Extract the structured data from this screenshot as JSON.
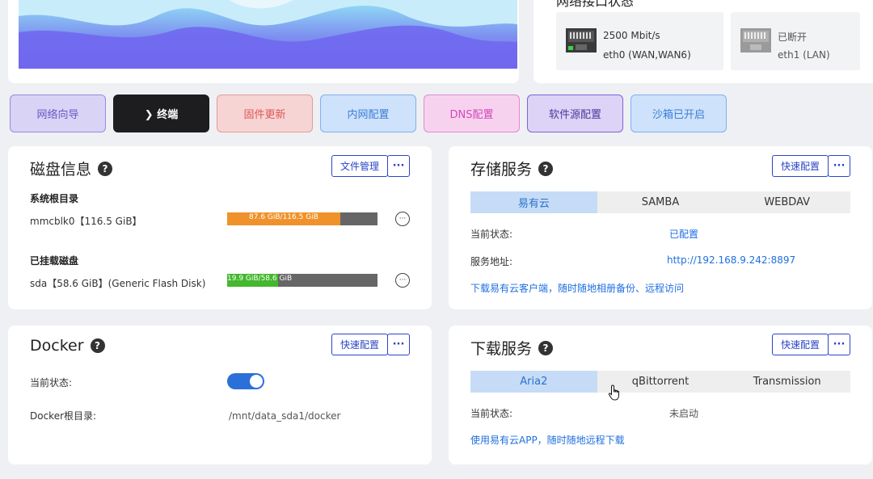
{
  "network": {
    "title": "网络接口状态",
    "more": "···",
    "ports": [
      {
        "line1": "2500 Mbit/s",
        "line2": "eth0 (WAN,WAN6)",
        "status": "connected"
      },
      {
        "line1": "已断开",
        "line2": "eth1 (LAN)",
        "status": "disconnected"
      }
    ]
  },
  "quick_buttons": [
    {
      "label": "网络向导",
      "bg": "#d9d3f6",
      "border": "#9a88e0",
      "color": "#6a58c4"
    },
    {
      "label": "❯ 终端",
      "bg": "#1d1d1f",
      "border": "#1d1d1f",
      "color": "#ffffff"
    },
    {
      "label": "固件更新",
      "bg": "#f7d4d4",
      "border": "#e59a9a",
      "color": "#e05555"
    },
    {
      "label": "内网配置",
      "bg": "#cfe2fb",
      "border": "#7fb0ef",
      "color": "#3b7fd6"
    },
    {
      "label": "DNS配置",
      "bg": "#f7d2ef",
      "border": "#e08ad0",
      "color": "#d04ab8"
    },
    {
      "label": "软件源配置",
      "bg": "#dcd3f6",
      "border": "#7e64d8",
      "color": "#4a3a9a"
    },
    {
      "label": "沙箱已开启",
      "bg": "#cfe2fb",
      "border": "#7fb0ef",
      "color": "#3b7fd6"
    }
  ],
  "disk": {
    "title": "磁盘信息",
    "help": "?",
    "manage_button": "文件管理",
    "more": "···",
    "root_heading": "系统根目录",
    "root_name": "mmcblk0【116.5 GiB】",
    "root_usage": "87.6 GiB/116.5 GiB",
    "root_used_fraction": 0.752,
    "root_color": "#f0922b",
    "mounted_heading": "已挂载磁盘",
    "mounted_name": "sda【58.6 GiB】(Generic Flash Disk)",
    "mounted_usage": "19.9 GiB/58.6 GiB",
    "mounted_used_fraction": 0.34,
    "mounted_color": "#44b72e",
    "row_more": "···"
  },
  "storage": {
    "title": "存储服务",
    "help": "?",
    "config_button": "快速配置",
    "more": "···",
    "tabs": [
      "易有云",
      "SAMBA",
      "WEBDAV"
    ],
    "status_label": "当前状态:",
    "status_value": "已配置",
    "address_label": "服务地址:",
    "address_value": "http://192.168.9.242:8897",
    "footer_link": "下载易有云客户端，随时随地相册备份、远程访问"
  },
  "docker": {
    "title": "Docker",
    "help": "?",
    "config_button": "快速配置",
    "more": "···",
    "status_label": "当前状态:",
    "status_on": true,
    "root_label": "Docker根目录:",
    "root_value": "/mnt/data_sda1/docker"
  },
  "download": {
    "title": "下载服务",
    "help": "?",
    "config_button": "快速配置",
    "more": "···",
    "tabs": [
      "Aria2",
      "qBittorrent",
      "Transmission"
    ],
    "status_label": "当前状态:",
    "status_value": "未启动",
    "footer_link": "使用易有云APP，随时随地远程下载"
  }
}
